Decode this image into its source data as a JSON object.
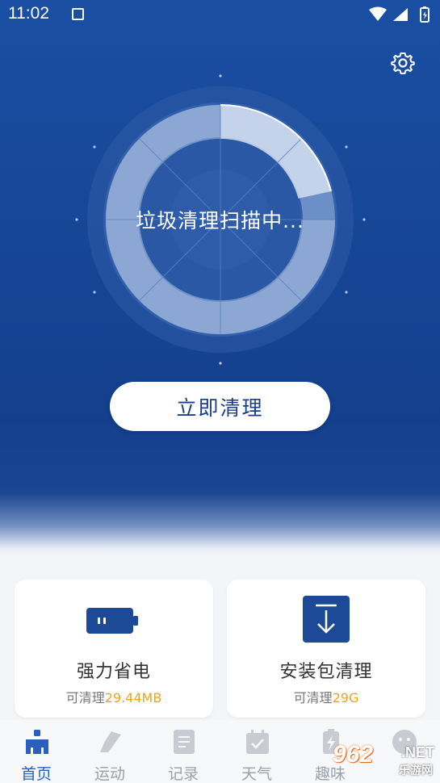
{
  "status_bar": {
    "time": "11:02"
  },
  "icons": {
    "settings": "gear-icon",
    "battery_card": "battery-icon",
    "package_card": "download-icon"
  },
  "scanner": {
    "title": "垃圾清理扫描中..."
  },
  "main": {
    "clean_button_label": "立即清理"
  },
  "cards": [
    {
      "title": "强力省电",
      "sub_prefix": "可清理",
      "sub_value": "29.44MB"
    },
    {
      "title": "安装包清理",
      "sub_prefix": "可清理",
      "sub_value": "29G"
    }
  ],
  "tabs": [
    {
      "label": "首页",
      "active": true,
      "icon": "home-broom-icon"
    },
    {
      "label": "运动",
      "active": false,
      "icon": "shoe-icon"
    },
    {
      "label": "记录",
      "active": false,
      "icon": "document-icon"
    },
    {
      "label": "天气",
      "active": false,
      "icon": "calendar-check-icon"
    },
    {
      "label": "趣味",
      "active": false,
      "icon": "bolt-icon"
    },
    {
      "label": "",
      "active": false,
      "icon": "face-icon"
    }
  ],
  "watermark": {
    "brand": "962",
    "suffix": ".NET",
    "sub": "乐游网"
  },
  "colors": {
    "primary_blue": "#1a4fa3",
    "accent_orange": "#f0a318",
    "active_tab": "#2a5fc0",
    "inactive_tab": "#9aa0a8"
  }
}
